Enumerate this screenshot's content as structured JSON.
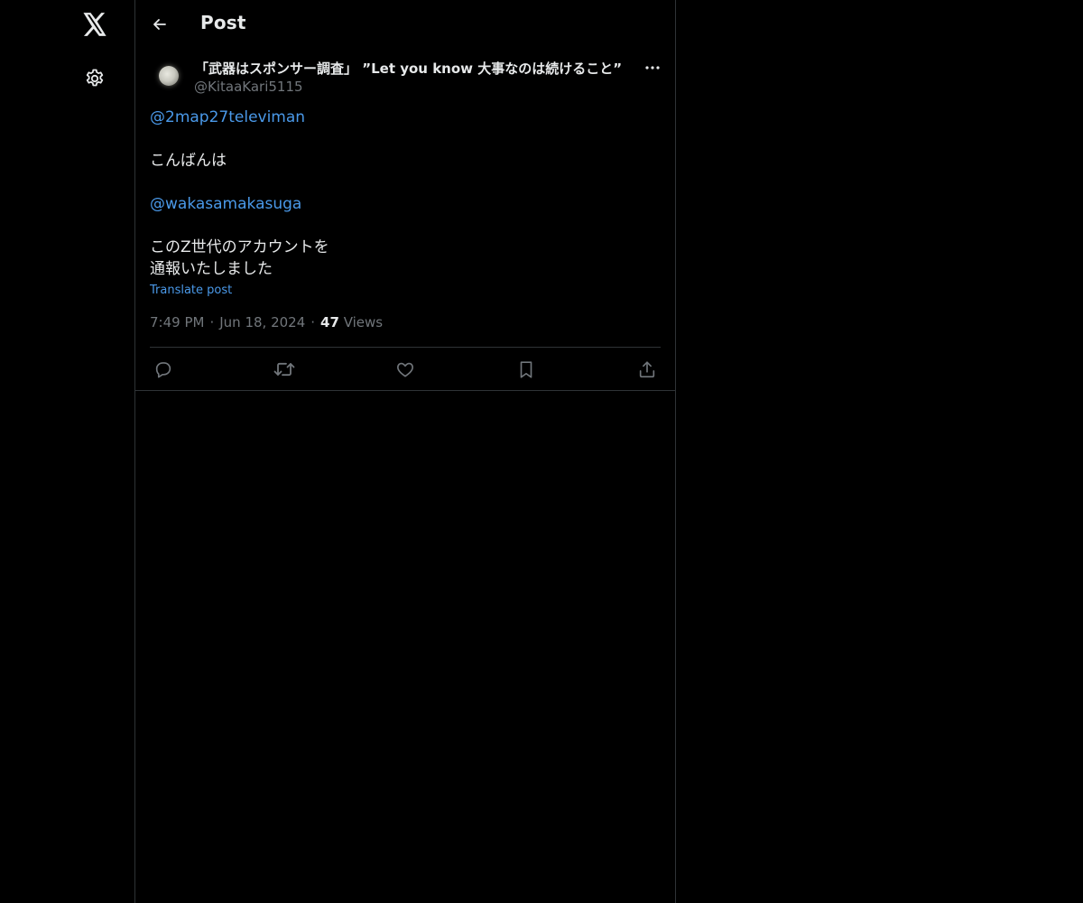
{
  "app": {
    "logo_icon": "x-logo-icon",
    "settings_icon": "gear-icon"
  },
  "header": {
    "title": "Post",
    "back_icon": "arrow-left-icon"
  },
  "post": {
    "author": {
      "display_name": "「武器はスポンサー調査」 ”Let you know 大事なのは続けること”",
      "handle": "@KitaaKari5115",
      "avatar_icon": "moon-avatar"
    },
    "more_icon": "more-horizontal-icon",
    "body": {
      "mention_1": "@2map27televiman",
      "line_greeting": "こんばんは",
      "mention_2": "@wakasamakasuga",
      "line_3": "このZ世代のアカウントを",
      "line_4": "通報いたしました"
    },
    "translate_label": "Translate post",
    "meta": {
      "time": "7:49 PM",
      "date": "Jun 18, 2024",
      "views_count": "47",
      "views_label": "Views",
      "separator": "·"
    },
    "actions": {
      "reply_icon": "reply-icon",
      "repost_icon": "repost-icon",
      "like_icon": "heart-icon",
      "bookmark_icon": "bookmark-icon",
      "share_icon": "share-icon"
    }
  },
  "colors": {
    "background": "#000000",
    "text_primary": "#e7e9ea",
    "text_secondary": "#71767b",
    "link": "#4a99e9",
    "border": "#2f3336"
  }
}
